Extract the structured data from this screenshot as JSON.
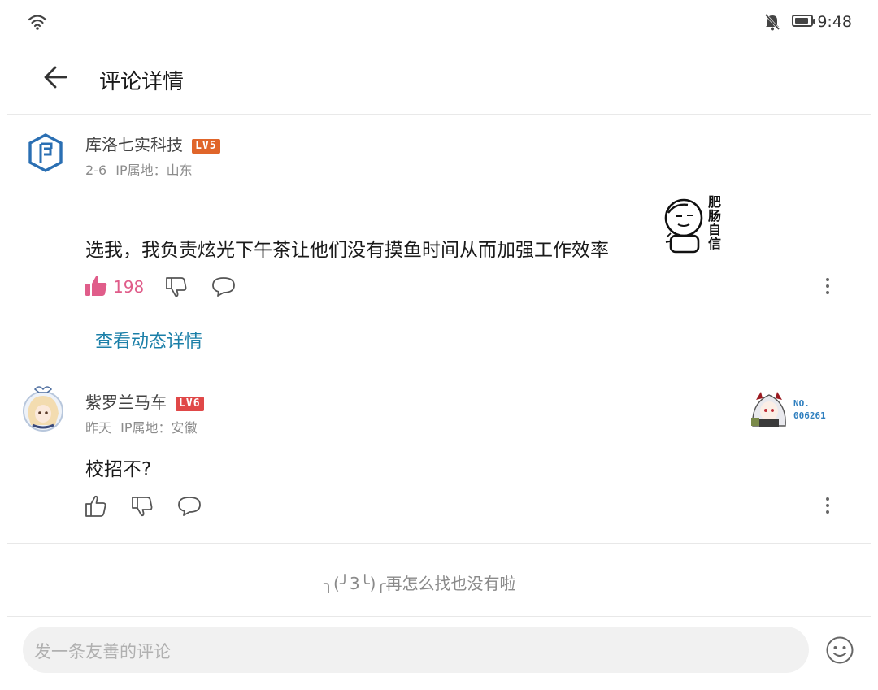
{
  "status_bar": {
    "time": "9:48"
  },
  "header": {
    "title": "评论详情"
  },
  "comments": [
    {
      "user": "库洛七实科技",
      "level": "LV5",
      "level_color": "#e0652a",
      "date": "2-6",
      "ip_label": "IP属地：",
      "ip_location": "山东",
      "text": "选我，我负责炫光下午茶让他们没有摸鱼时间从而加强工作效率",
      "sticker_chars": [
        "肥",
        "肠",
        "自",
        "信"
      ],
      "likes": "198",
      "view_detail": "查看动态详情"
    },
    {
      "user": "紫罗兰马车",
      "level": "LV6",
      "level_color": "#e04848",
      "date": "昨天",
      "ip_label": "IP属地：",
      "ip_location": "安徽",
      "text": "校招不?",
      "badge_no": "NO.",
      "badge_id": "006261"
    }
  ],
  "end_message": "╮(╯3╰)╭再怎么找也没有啦",
  "input": {
    "placeholder": "发一条友善的评论"
  },
  "colors": {
    "like_active": "#e05d8a",
    "link": "#1b7fa8",
    "brand": "#2a6fb3"
  }
}
